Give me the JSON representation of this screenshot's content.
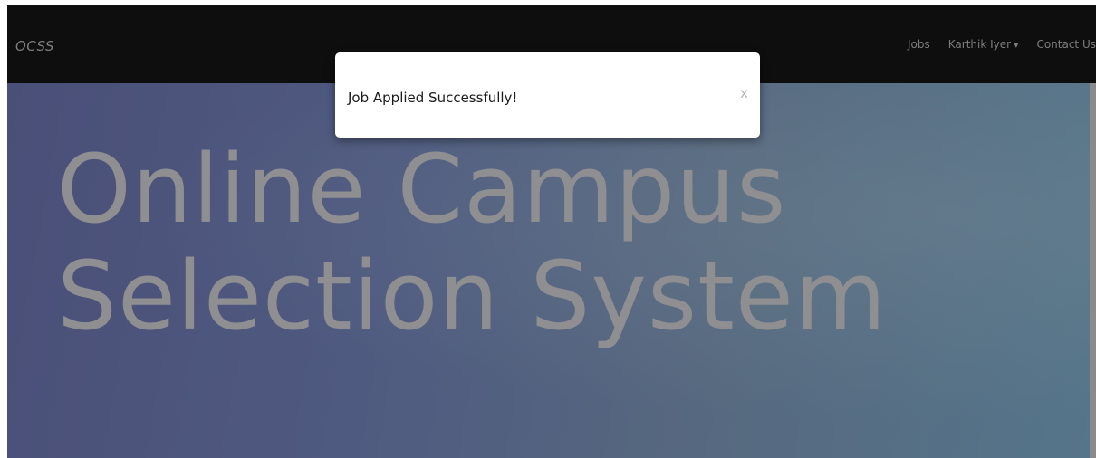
{
  "navbar": {
    "brand": "OCSS",
    "links": {
      "jobs": "Jobs",
      "user": "Karthik Iyer",
      "contact": "Contact Us"
    }
  },
  "hero": {
    "title": "Online Campus Selection System"
  },
  "modal": {
    "message": "Job Applied Successfully!",
    "close_label": "x"
  },
  "colors": {
    "navbar_bg": "#0e0e0e",
    "nav_text": "#7d7d7d",
    "hero_title": "#8f8f92",
    "hero_gradient_start": "#4a4f78",
    "hero_gradient_end": "#55758a"
  },
  "icons": {
    "user_dropdown": "caret-down-icon"
  }
}
